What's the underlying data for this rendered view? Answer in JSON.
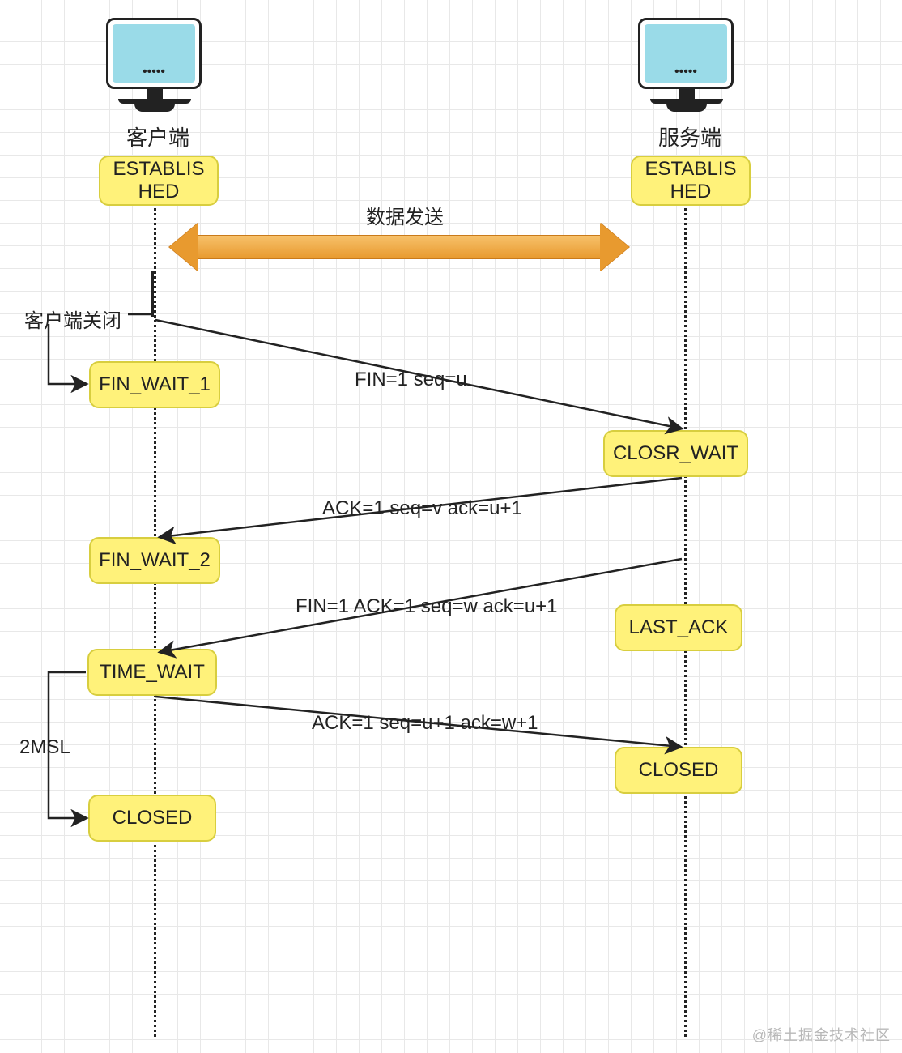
{
  "client": {
    "title": "客户端",
    "states": {
      "established": "ESTABLIS\nHED",
      "fin_wait_1": "FIN_WAIT_1",
      "fin_wait_2": "FIN_WAIT_2",
      "time_wait": "TIME_WAIT",
      "closed": "CLOSED"
    },
    "close_label": "客户端关闭",
    "wait_label": "2MSL"
  },
  "server": {
    "title": "服务端",
    "states": {
      "established": "ESTABLIS\nHED",
      "close_wait": "CLOSR_WAIT",
      "last_ack": "LAST_ACK",
      "closed": "CLOSED"
    }
  },
  "messages": {
    "data_transfer": "数据发送",
    "fin1": "FIN=1 seq=u",
    "ack1": "ACK=1 seq=v ack=u+1",
    "fin2": "FIN=1 ACK=1 seq=w ack=u+1",
    "ack2": "ACK=1 seq=u+1 ack=w+1"
  },
  "watermark": "@稀土掘金技术社区"
}
